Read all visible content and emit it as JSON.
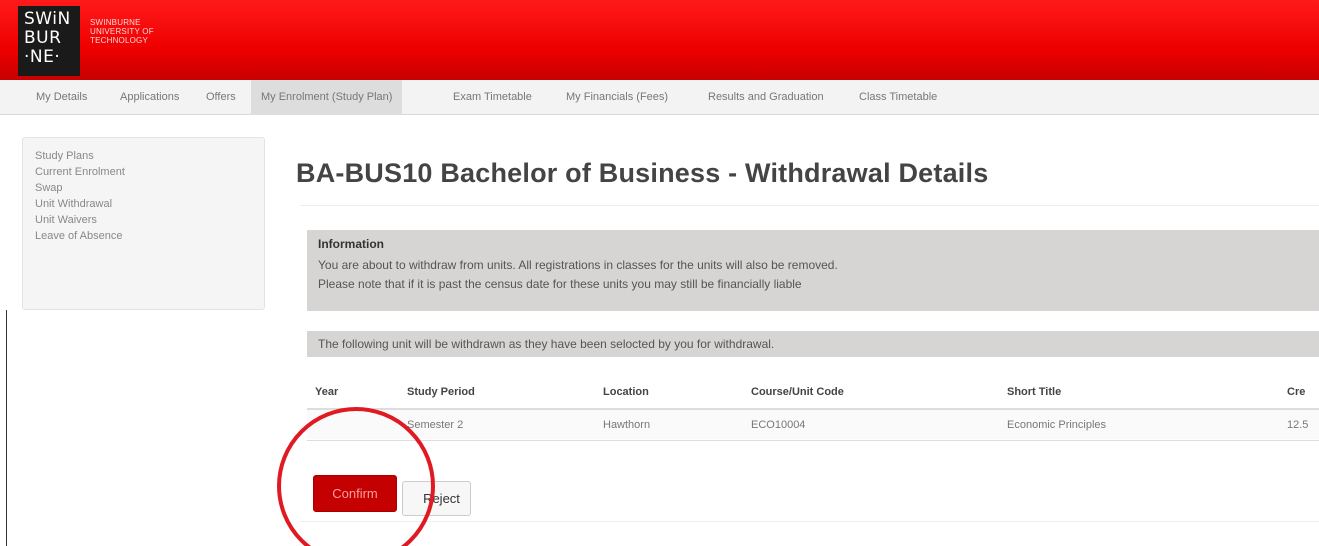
{
  "brand": {
    "logo_lines": [
      "SWiN",
      "BUR",
      "·NE·"
    ],
    "name_lines": [
      "SWINBURNE",
      "UNIVERSITY OF",
      "TECHNOLOGY"
    ],
    "header_color": "#ee0000"
  },
  "nav": {
    "items": [
      {
        "label": "My Details"
      },
      {
        "label": "Applications"
      },
      {
        "label": "Offers"
      },
      {
        "label": "My Enrolment (Study Plan)",
        "active": true
      },
      {
        "label": "Exam Timetable"
      },
      {
        "label": "My Financials (Fees)"
      },
      {
        "label": "Results and Graduation"
      },
      {
        "label": "Class Timetable"
      }
    ]
  },
  "sidebar": {
    "items": [
      {
        "label": "Study Plans"
      },
      {
        "label": "Current Enrolment"
      },
      {
        "label": "Swap"
      },
      {
        "label": "Unit Withdrawal"
      },
      {
        "label": "Unit Waivers"
      },
      {
        "label": "Leave of Absence"
      }
    ]
  },
  "main": {
    "title": "BA-BUS10 Bachelor of Business - Withdrawal Details",
    "info": {
      "heading": "Information",
      "lines": [
        "You are about to withdraw from units. All registrations in classes for the units will also be removed.",
        "Please note that if it is past the census date for these units you may still be financially liable"
      ]
    },
    "notice": "The following unit will be withdrawn as they have been selocted by you for withdrawal.",
    "table": {
      "headers": [
        "Year",
        "Study Period",
        "Location",
        "Course/Unit Code",
        "Short Title",
        "Cre"
      ],
      "rows": [
        [
          "",
          "Semester 2",
          "Hawthorn",
          "ECO10004",
          "Economic Principles",
          "12.5"
        ]
      ]
    },
    "buttons": {
      "confirm": "Confirm",
      "reject": "Reject"
    },
    "highlight_color": "#e01a22"
  }
}
